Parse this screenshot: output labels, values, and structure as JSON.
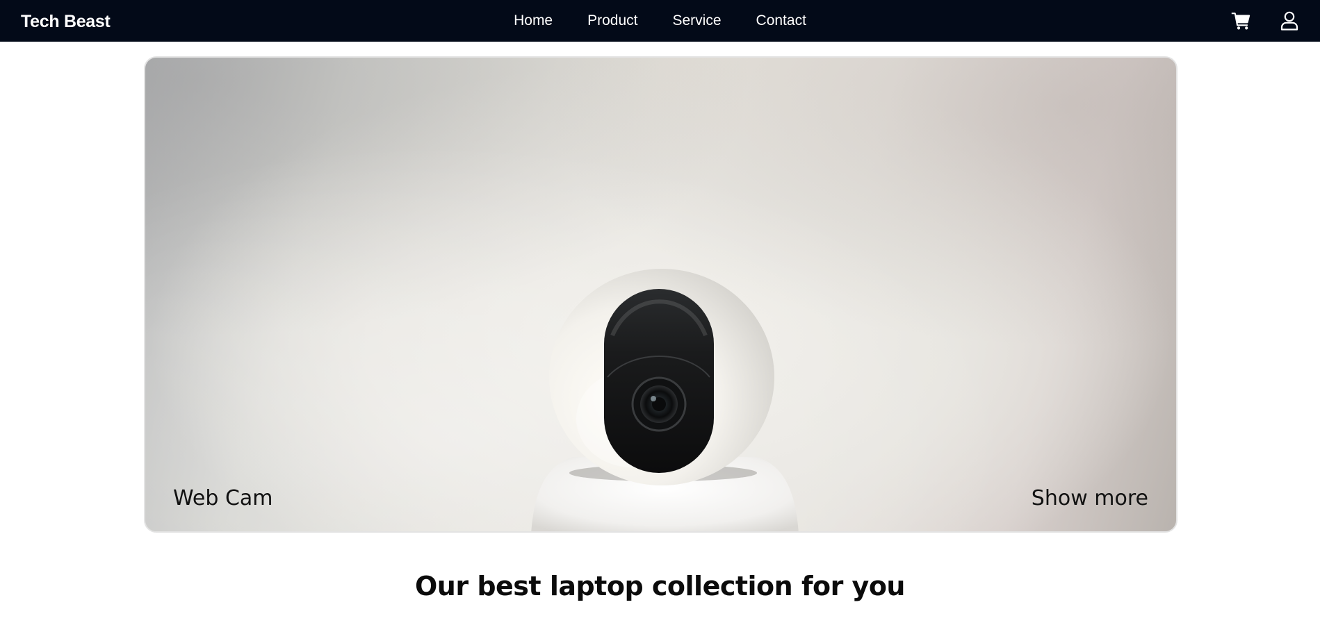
{
  "navbar": {
    "brand": "Tech Beast",
    "links": [
      {
        "label": "Home"
      },
      {
        "label": "Product"
      },
      {
        "label": "Service"
      },
      {
        "label": "Contact"
      }
    ],
    "icons": [
      "cart-icon",
      "user-icon"
    ],
    "background_color": "#030a18",
    "text_color": "#ffffff"
  },
  "hero": {
    "caption_left": "Web Cam",
    "caption_right": "Show more",
    "image_subject": "white dome security webcam"
  },
  "section": {
    "title": "Our best laptop collection for you"
  }
}
